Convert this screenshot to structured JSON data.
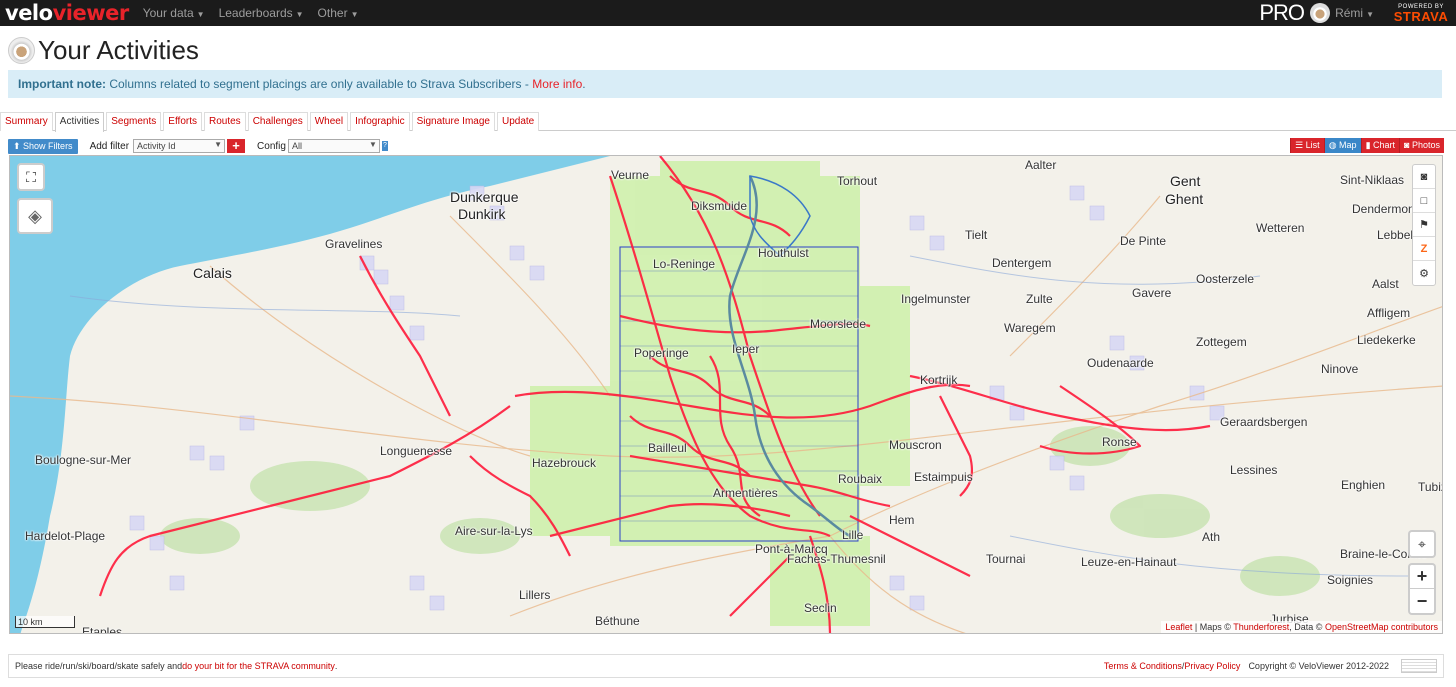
{
  "nav": {
    "logo_part1": "velo",
    "logo_part2": "viewer",
    "items": [
      "Your data",
      "Leaderboards",
      "Other"
    ],
    "pro_label": "PRO",
    "user": "Rémi",
    "powered_by": "POWERED BY",
    "strava": "STRAVA"
  },
  "header": {
    "title": "Your Activities"
  },
  "note": {
    "bold": "Important note:",
    "text": " Columns related to segment placings are only available to Strava Subscribers - ",
    "link": "More info",
    "end": "."
  },
  "tabs": [
    "Summary",
    "Activities",
    "Segments",
    "Efforts",
    "Routes",
    "Challenges",
    "Wheel",
    "Infographic",
    "Signature Image",
    "Update"
  ],
  "active_tab": "Activities",
  "filterbar": {
    "show_filters": "Show Filters",
    "add_filter_label": "Add filter",
    "add_filter_value": "Activity Id",
    "add_button": "+",
    "config_label": "Config",
    "config_value": "All",
    "help": "?",
    "views": [
      "List",
      "Map",
      "Chart",
      "Photos"
    ],
    "active_view": "Map"
  },
  "map": {
    "places": [
      {
        "name": "Aalter",
        "big": false
      },
      {
        "name": "Veurne",
        "big": false
      },
      {
        "name": "Torhout",
        "big": false
      },
      {
        "name": "Gent",
        "big": true
      },
      {
        "name": "Ghent",
        "big": true
      },
      {
        "name": "Sint-Niklaas",
        "big": false
      },
      {
        "name": "Dendermonde",
        "big": false
      },
      {
        "name": "Lebbeke",
        "big": false
      },
      {
        "name": "Dunkerque",
        "big": true
      },
      {
        "name": "Dunkirk",
        "big": true
      },
      {
        "name": "Diksmuide",
        "big": false
      },
      {
        "name": "Houthulst",
        "big": false
      },
      {
        "name": "Tielt",
        "big": false
      },
      {
        "name": "De Pinte",
        "big": false
      },
      {
        "name": "Wetteren",
        "big": false
      },
      {
        "name": "Gravelines",
        "big": false
      },
      {
        "name": "Calais",
        "big": true
      },
      {
        "name": "Lo-Reninge",
        "big": false
      },
      {
        "name": "Dentergem",
        "big": false
      },
      {
        "name": "Oosterzele",
        "big": false
      },
      {
        "name": "Aalst",
        "big": false
      },
      {
        "name": "Ingelmunster",
        "big": false
      },
      {
        "name": "Zulte",
        "big": false
      },
      {
        "name": "Gavere",
        "big": false
      },
      {
        "name": "Affligem",
        "big": false
      },
      {
        "name": "Moorslede",
        "big": false
      },
      {
        "name": "Waregem",
        "big": false
      },
      {
        "name": "Zottegem",
        "big": false
      },
      {
        "name": "Liedekerke",
        "big": false
      },
      {
        "name": "Poperinge",
        "big": false
      },
      {
        "name": "Ieper",
        "big": false
      },
      {
        "name": "Oudenaarde",
        "big": false
      },
      {
        "name": "Ninove",
        "big": false
      },
      {
        "name": "Kortrijk",
        "big": false
      },
      {
        "name": "Geraardsbergen",
        "big": false
      },
      {
        "name": "Ronse",
        "big": false
      },
      {
        "name": "Mouscron",
        "big": false
      },
      {
        "name": "Boulogne-sur-Mer",
        "big": false
      },
      {
        "name": "Longuenesse",
        "big": false
      },
      {
        "name": "Hazebrouck",
        "big": false
      },
      {
        "name": "Bailleul",
        "big": false
      },
      {
        "name": "Lessines",
        "big": false
      },
      {
        "name": "Estaimpuis",
        "big": false
      },
      {
        "name": "Roubaix",
        "big": false
      },
      {
        "name": "Enghien",
        "big": false
      },
      {
        "name": "Tubize",
        "big": false
      },
      {
        "name": "Armentières",
        "big": false
      },
      {
        "name": "Hem",
        "big": false
      },
      {
        "name": "Hardelot-Plage",
        "big": false
      },
      {
        "name": "Aire-sur-la-Lys",
        "big": false
      },
      {
        "name": "Lille",
        "big": false
      },
      {
        "name": "Ath",
        "big": false
      },
      {
        "name": "Braine-le-Comte",
        "big": false
      },
      {
        "name": "Tournai",
        "big": false
      },
      {
        "name": "Leuze-en-Hainaut",
        "big": false
      },
      {
        "name": "Pont-à-Marcq",
        "big": false
      },
      {
        "name": "Faches-Thumesnil",
        "big": false
      },
      {
        "name": "Soignies",
        "big": false
      },
      {
        "name": "Lillers",
        "big": false
      },
      {
        "name": "Seclin",
        "big": false
      },
      {
        "name": "Jurbise",
        "big": false
      },
      {
        "name": "Béthune",
        "big": false
      },
      {
        "name": "Etaples",
        "big": false
      }
    ],
    "scale": "10 km",
    "attribution": {
      "leaflet": "Leaflet",
      "maps_by": " | Maps © ",
      "thunderforest": "Thunderforest",
      "data": ", Data © ",
      "osm": "OpenStreetMap contributors"
    },
    "controls": {
      "fullscreen_icon": "fullscreen-icon",
      "layers_icon": "layers-icon",
      "locate_icon": "locate-icon",
      "zoom_in": "+",
      "zoom_out": "−"
    }
  },
  "footer": {
    "text": "Please ride/run/ski/board/skate safely and ",
    "link": "do your bit for the STRAVA community",
    "end": ".",
    "terms": "Terms & Conditions",
    "sep": " / ",
    "privacy": "Privacy Policy",
    "copyright": "Copyright © VeloViewer 2012-2022"
  },
  "colors": {
    "accent_red": "#e8232a",
    "activity_route": "#ff1a3a",
    "cluster_fill": "#c8f0a0",
    "grid_blue": "#2a3fc8",
    "sea": "#7fcde8"
  }
}
